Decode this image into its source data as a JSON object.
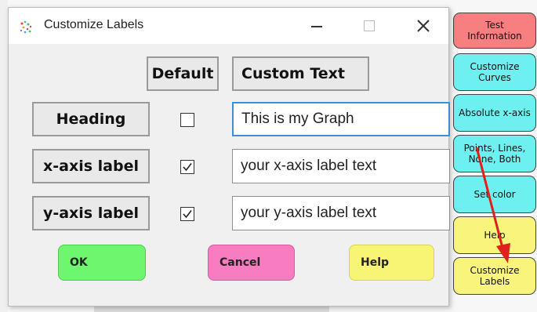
{
  "dialog": {
    "title": "Customize Labels",
    "col_default": "Default",
    "col_custom": "Custom Text",
    "rows": [
      {
        "label": "Heading",
        "checked": false,
        "value": "This is my Graph"
      },
      {
        "label": "x-axis label",
        "checked": true,
        "value": "your x-axis label text"
      },
      {
        "label": "y-axis label",
        "checked": true,
        "value": "your y-axis label text"
      }
    ],
    "buttons": {
      "ok": "OK",
      "cancel": "Cancel",
      "help": "Help"
    },
    "window_controls": {
      "minimize": "—",
      "maximize": "☐",
      "close": "✕"
    }
  },
  "side_panel": {
    "items": [
      {
        "label": "Test Information",
        "color": "#f77f7f"
      },
      {
        "label": "Customize Curves",
        "color": "#6ff0f0"
      },
      {
        "label": "Absolute x-axis",
        "color": "#6ff0f0"
      },
      {
        "label": "Points, Lines, None, Both",
        "color": "#6ff0f0"
      },
      {
        "label": "Set color",
        "color": "#6ff0f0"
      },
      {
        "label": "Help",
        "color": "#f8f47c"
      },
      {
        "label": "Customize Labels",
        "color": "#f8f47c"
      }
    ]
  },
  "annotation": {
    "arrow_color": "#e0201a"
  }
}
